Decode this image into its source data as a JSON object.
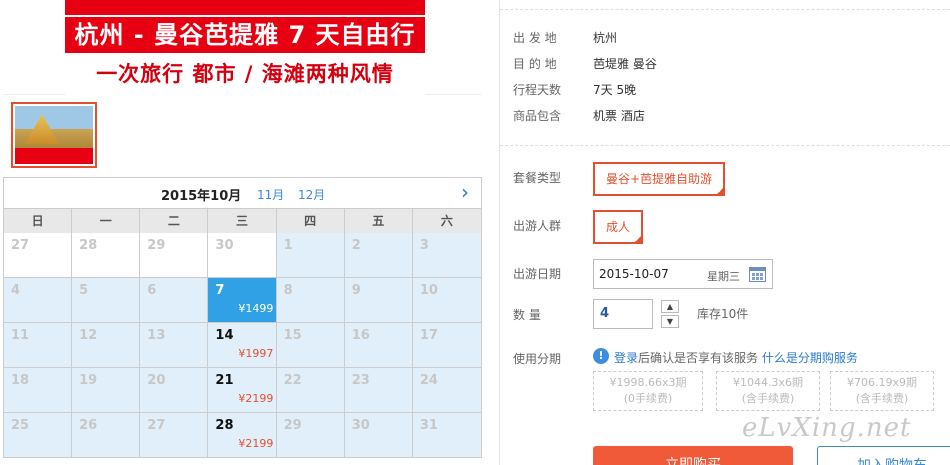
{
  "banner": {
    "title": "杭州 - 曼谷芭提雅 7 天自由行",
    "subtitle": "一次旅行  都市 / 海滩两种风情"
  },
  "calendar": {
    "current_month": "2015年10月",
    "next_link_1": "11月",
    "next_link_2": "12月",
    "next_arrow": "›",
    "weekdays": [
      "日",
      "一",
      "二",
      "三",
      "四",
      "五",
      "六"
    ],
    "days": [
      {
        "day": "27",
        "price": ""
      },
      {
        "day": "28",
        "price": ""
      },
      {
        "day": "29",
        "price": ""
      },
      {
        "day": "30",
        "price": ""
      },
      {
        "day": "1",
        "price": ""
      },
      {
        "day": "2",
        "price": ""
      },
      {
        "day": "3",
        "price": ""
      },
      {
        "day": "4",
        "price": ""
      },
      {
        "day": "5",
        "price": ""
      },
      {
        "day": "6",
        "price": ""
      },
      {
        "day": "7",
        "price": "¥1499"
      },
      {
        "day": "8",
        "price": ""
      },
      {
        "day": "9",
        "price": ""
      },
      {
        "day": "10",
        "price": ""
      },
      {
        "day": "11",
        "price": ""
      },
      {
        "day": "12",
        "price": ""
      },
      {
        "day": "13",
        "price": ""
      },
      {
        "day": "14",
        "price": "¥1997"
      },
      {
        "day": "15",
        "price": ""
      },
      {
        "day": "16",
        "price": ""
      },
      {
        "day": "17",
        "price": ""
      },
      {
        "day": "18",
        "price": ""
      },
      {
        "day": "19",
        "price": ""
      },
      {
        "day": "20",
        "price": ""
      },
      {
        "day": "21",
        "price": "¥2199"
      },
      {
        "day": "22",
        "price": ""
      },
      {
        "day": "23",
        "price": ""
      },
      {
        "day": "24",
        "price": ""
      },
      {
        "day": "25",
        "price": ""
      },
      {
        "day": "26",
        "price": ""
      },
      {
        "day": "27",
        "price": ""
      },
      {
        "day": "28",
        "price": "¥2199"
      },
      {
        "day": "29",
        "price": ""
      },
      {
        "day": "30",
        "price": ""
      },
      {
        "day": "31",
        "price": ""
      }
    ]
  },
  "details": {
    "departure_label": "出 发 地",
    "departure_value": "杭州",
    "destination_label": "目 的 地",
    "destination_value": "芭堤雅   曼谷",
    "days_label": "行程天数",
    "days_value": "7天 5晚",
    "includes_label": "商品包含",
    "includes_value": "机票   酒店"
  },
  "options": {
    "package_label": "套餐类型",
    "package_value": "曼谷+芭提雅自助游",
    "people_label": "出游人群",
    "people_value": "成人",
    "date_label": "出游日期",
    "date_value": "2015-10-07",
    "date_weekday": "星期三",
    "quantity_label": "数     量",
    "quantity_value": "4",
    "qty_up": "▲",
    "qty_down": "▼",
    "stock": "库存10件"
  },
  "installment": {
    "label": "使用分期",
    "login": "登录",
    "text": "后确认是否享有该服务",
    "help": "什么是分期购服务",
    "plans": [
      {
        "price": "¥1998.66x3期",
        "fee": "(0手续费)"
      },
      {
        "price": "¥1044.3x6期",
        "fee": "(含手续费)"
      },
      {
        "price": "¥706.19x9期",
        "fee": "(含手续费)"
      }
    ]
  },
  "actions": {
    "buy": "立即购买",
    "cart": "加入购物车"
  },
  "watermark": "eLvXing.net"
}
